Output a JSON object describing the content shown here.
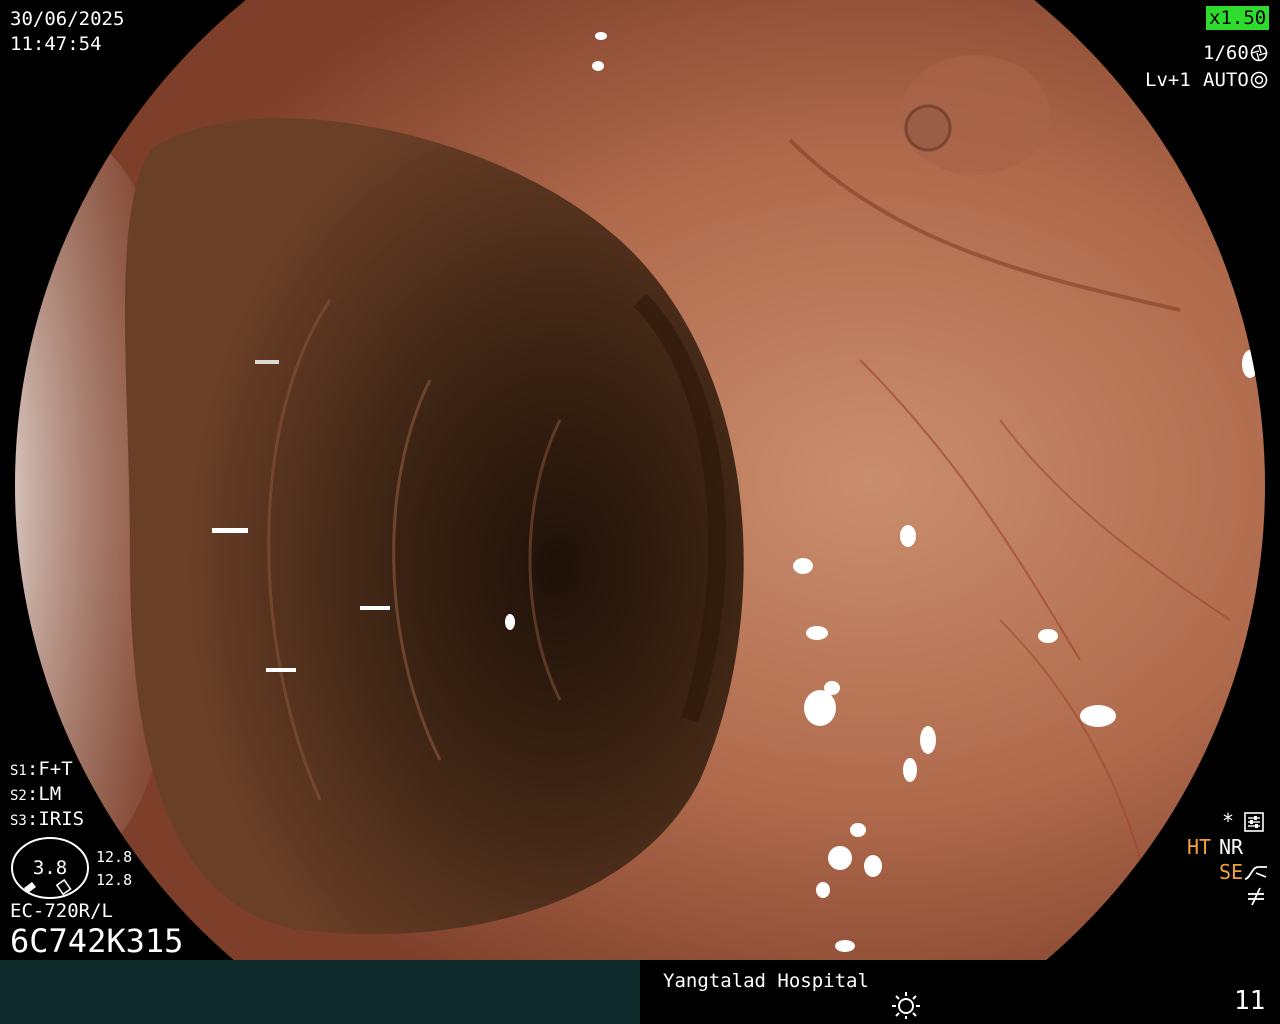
{
  "overlay": {
    "date": "30/06/2025",
    "time": "11:47:54",
    "zoom": "x1.50",
    "shutter": "1/60",
    "enhancement_level": "Lv+1",
    "iris_mode": "AUTO",
    "structure_settings": [
      {
        "label": "S1",
        "value": "F+T"
      },
      {
        "label": "S2",
        "value": "LM"
      },
      {
        "label": "S3",
        "value": "IRIS"
      }
    ],
    "gauge": {
      "center_value": "3.8",
      "value_top": "12.8",
      "value_bottom": "12.8"
    },
    "scope_model": "EC-720R/L",
    "scope_serial": "6C742K315",
    "mode_indicators": {
      "star": "*",
      "ht": "HT",
      "nr": "NR",
      "se": "SE"
    },
    "hospital": "Yangtalad Hospital",
    "page_number": "11",
    "colors": {
      "zoom_badge": "#2ddc2d",
      "accent_orange": "#f2a23a",
      "status_bar": "#0e2a2a"
    },
    "icons": [
      "shutter-icon",
      "iris-icon",
      "settings-icon",
      "se-curve-icon",
      "not-equal-icon",
      "light-icon"
    ]
  }
}
